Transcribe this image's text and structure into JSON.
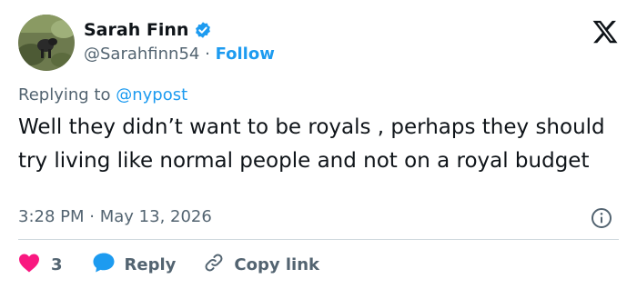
{
  "author": {
    "name": "Sarah Finn",
    "handle": "@Sarahfinn54",
    "separator": "·",
    "follow_label": "Follow",
    "verified": true
  },
  "reply_context": {
    "prefix": "Replying to",
    "mention": "@nypost"
  },
  "tweet": {
    "text": "Well they didn’t want to be royals , perhaps they should try living like normal people and not on a royal budget",
    "time": "3:28 PM",
    "separator": "·",
    "date": "May 13, 2026"
  },
  "actions": {
    "like_count": "3",
    "reply_label": "Reply",
    "copy_link_label": "Copy link"
  },
  "colors": {
    "link_blue": "#1d9bf0",
    "heart_red": "#f91880",
    "muted_text": "#536471",
    "primary_text": "#0f1419"
  },
  "icons": {
    "verified": "verified-badge-icon",
    "brand": "x-logo-icon",
    "info": "info-icon",
    "like": "heart-icon",
    "reply": "speech-bubble-icon",
    "copy_link": "link-icon"
  }
}
